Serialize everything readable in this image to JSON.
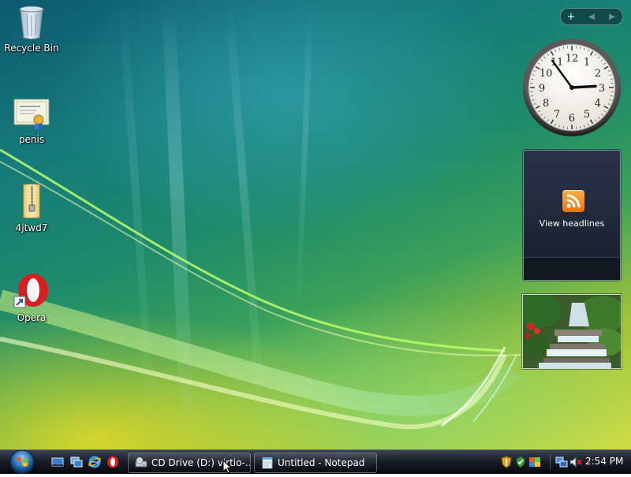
{
  "desktop": {
    "icons": [
      {
        "label": "Recycle Bin",
        "icon": "recycle-bin-icon"
      },
      {
        "label": "penis",
        "icon": "certificate-document-icon"
      },
      {
        "label": "4jtwd7",
        "icon": "zip-folder-icon"
      },
      {
        "label": "Opera",
        "icon": "opera-shortcut-icon"
      }
    ]
  },
  "sidebar": {
    "controls": {
      "add": "+",
      "prev": "◀",
      "next": "▶"
    },
    "clock": {
      "hours": 2,
      "minutes": 54,
      "numbers": [
        "12",
        "1",
        "2",
        "3",
        "4",
        "5",
        "6",
        "7",
        "8",
        "9",
        "10",
        "11"
      ]
    },
    "feed": {
      "label": "View headlines",
      "icon": "rss-icon"
    },
    "slideshow": {
      "icon": "waterfall-photo"
    }
  },
  "taskbar": {
    "start": {
      "icon": "windows-start-orb"
    },
    "quick_launch": [
      {
        "name": "show-desktop-icon"
      },
      {
        "name": "switch-windows-icon"
      },
      {
        "name": "internet-explorer-icon"
      },
      {
        "name": "opera-icon"
      }
    ],
    "tasks": [
      {
        "label": "CD Drive (D:) virtio-...",
        "icon": "cd-drive-icon"
      },
      {
        "label": "Untitled - Notepad",
        "icon": "notepad-icon"
      }
    ],
    "tray": {
      "icons": [
        "security-shield-icon",
        "network-icon",
        "action-center-icon",
        "network-connection-icon",
        "volume-muted-icon"
      ],
      "time": "2:54 PM"
    }
  },
  "colors": {
    "rss": "#f08a1c",
    "taskbar": "#0b0e13",
    "opera_red": "#d81e1e"
  }
}
